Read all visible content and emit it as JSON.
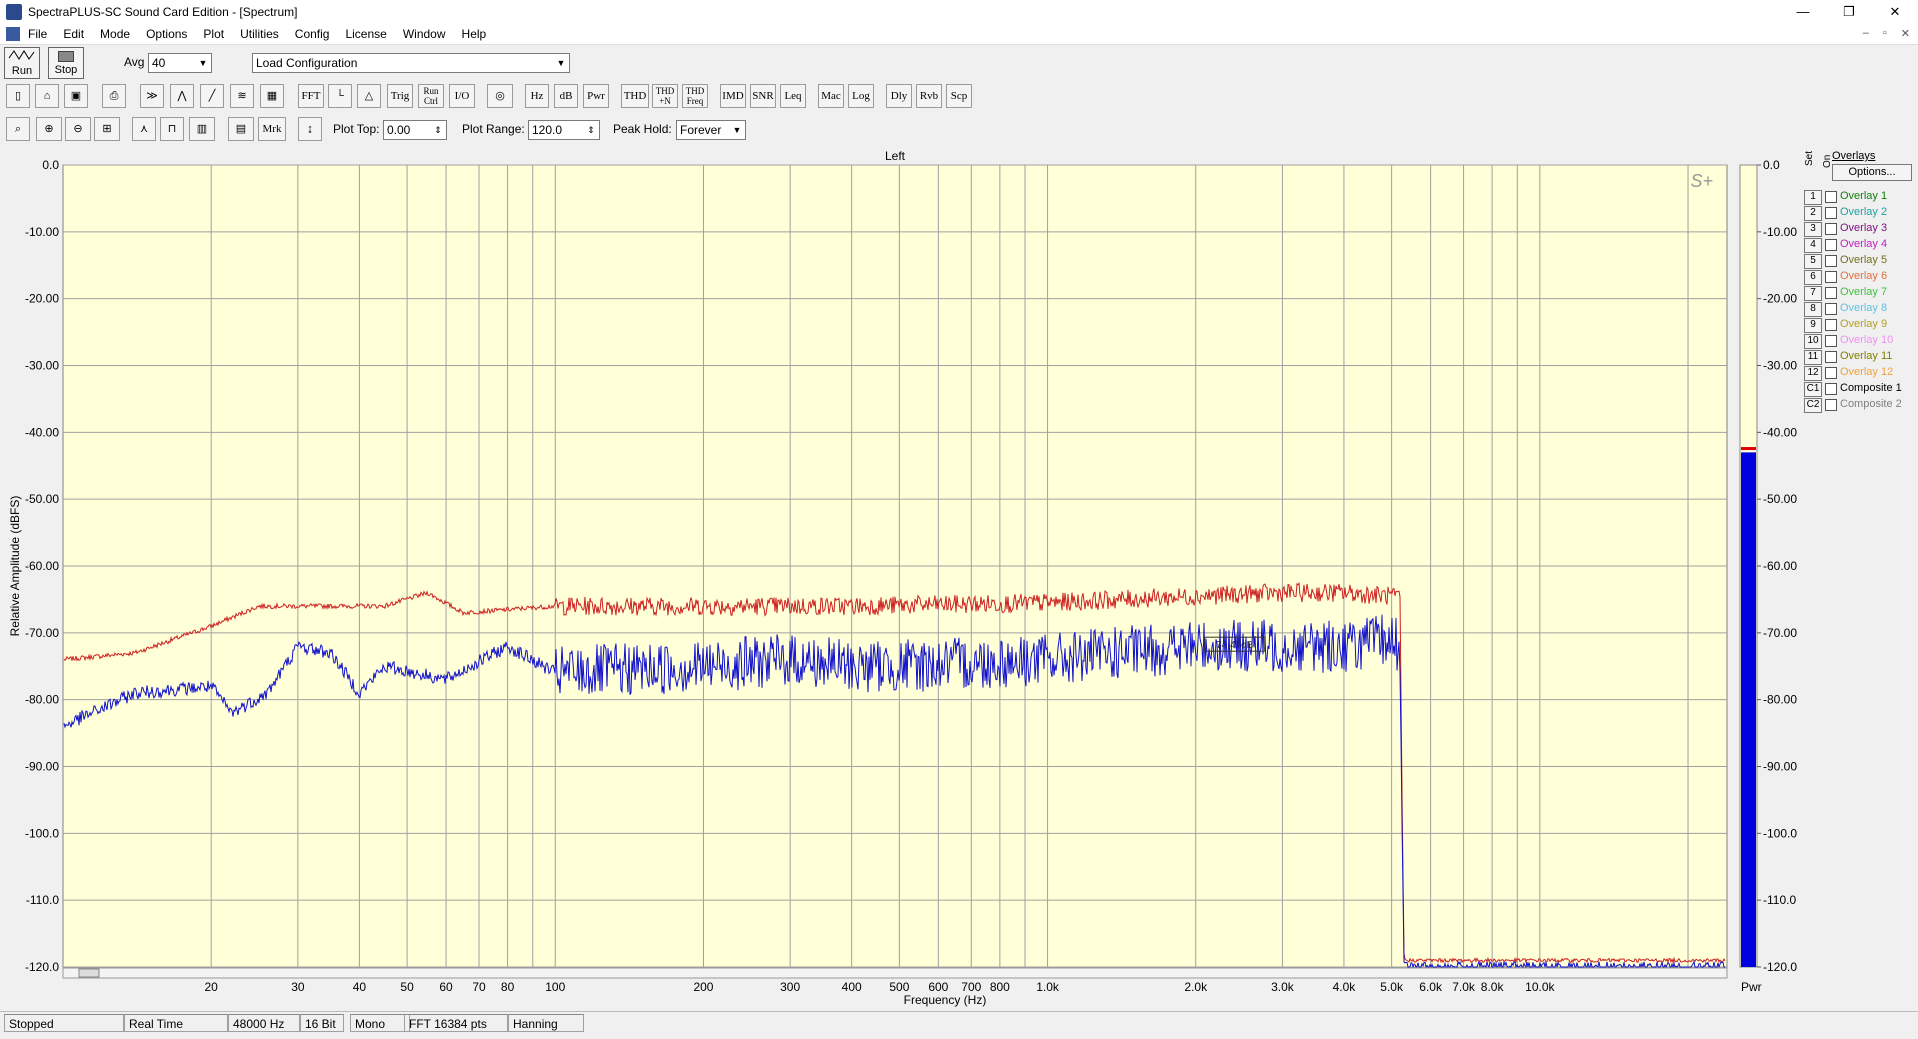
{
  "window": {
    "title": "SpectraPLUS-SC Sound Card Edition - [Spectrum]",
    "controls": [
      "—",
      "❐",
      "✕"
    ],
    "mdi_controls": [
      "–",
      "▫",
      "✕"
    ]
  },
  "menu": [
    "File",
    "Edit",
    "Mode",
    "Options",
    "Plot",
    "Utilities",
    "Config",
    "License",
    "Window",
    "Help"
  ],
  "toolbar1": {
    "run_label": "Run",
    "stop_label": "Stop",
    "avg_label": "Avg",
    "avg_value": "40",
    "config_value": "Load Configuration"
  },
  "toolbar2": [
    "FFT",
    "Trig",
    "Run Ctrl",
    "I/O",
    "Hz",
    "dB",
    "Pwr",
    "THD",
    "THD +N",
    "THD Freq",
    "IMD",
    "SNR",
    "Leq",
    "Mac",
    "Log",
    "Dly",
    "Rvb",
    "Scp"
  ],
  "toolbar3": {
    "buttons": [
      "Mrk"
    ],
    "plot_top_label": "Plot Top:",
    "plot_top_value": "0.00",
    "plot_range_label": "Plot Range:",
    "plot_range_value": "120.0",
    "peak_hold_label": "Peak Hold:",
    "peak_hold_value": "Forever"
  },
  "chart_data": {
    "type": "line",
    "title": "Left",
    "xlabel": "Frequency (Hz)",
    "ylabel": "Relative Amplitude (dBFS)",
    "x_scale": "log",
    "xlim": [
      10,
      24000
    ],
    "ylim": [
      -120,
      0
    ],
    "grid": true,
    "background": "#ffffd8",
    "y_ticks": [
      "0.0",
      "-10.00",
      "-20.00",
      "-30.00",
      "-40.00",
      "-50.00",
      "-60.00",
      "-70.00",
      "-80.00",
      "-90.00",
      "-100.0",
      "-110.0",
      "-120.0"
    ],
    "x_ticks": [
      {
        "v": 20,
        "label": "20"
      },
      {
        "v": 30,
        "label": "30"
      },
      {
        "v": 40,
        "label": "40"
      },
      {
        "v": 50,
        "label": "50"
      },
      {
        "v": 60,
        "label": "60"
      },
      {
        "v": 70,
        "label": "70"
      },
      {
        "v": 80,
        "label": "80"
      },
      {
        "v": 100,
        "label": "100"
      },
      {
        "v": 200,
        "label": "200"
      },
      {
        "v": 300,
        "label": "300"
      },
      {
        "v": 400,
        "label": "400"
      },
      {
        "v": 500,
        "label": "500"
      },
      {
        "v": 600,
        "label": "600"
      },
      {
        "v": 700,
        "label": "700"
      },
      {
        "v": 800,
        "label": "800"
      },
      {
        "v": 1000,
        "label": "1.0k"
      },
      {
        "v": 2000,
        "label": "2.0k"
      },
      {
        "v": 3000,
        "label": "3.0k"
      },
      {
        "v": 4000,
        "label": "4.0k"
      },
      {
        "v": 5000,
        "label": "5.0k"
      },
      {
        "v": 6000,
        "label": "6.0k"
      },
      {
        "v": 7000,
        "label": "7.0k"
      },
      {
        "v": 8000,
        "label": "8.0k"
      },
      {
        "v": 10000,
        "label": "10.0k"
      }
    ],
    "series": [
      {
        "color": "#cc2020",
        "points": [
          [
            10,
            -74
          ],
          [
            14,
            -73
          ],
          [
            20,
            -69
          ],
          [
            25,
            -66
          ],
          [
            35,
            -66
          ],
          [
            45,
            -66
          ],
          [
            55,
            -64
          ],
          [
            65,
            -67
          ],
          [
            100,
            -66
          ],
          [
            200,
            -66
          ],
          [
            400,
            -66
          ],
          [
            1000,
            -65.5
          ],
          [
            2000,
            -64.5
          ],
          [
            3000,
            -64
          ],
          [
            4000,
            -64
          ],
          [
            5000,
            -64.5
          ],
          [
            5200,
            -65
          ],
          [
            5250,
            -95
          ],
          [
            5300,
            -119
          ],
          [
            8000,
            -119
          ],
          [
            24000,
            -119
          ]
        ],
        "jitter": 1.4
      },
      {
        "color": "#1010cc",
        "points": [
          [
            10,
            -84
          ],
          [
            14,
            -79
          ],
          [
            20,
            -78
          ],
          [
            22,
            -82
          ],
          [
            26,
            -79
          ],
          [
            30,
            -72
          ],
          [
            35,
            -73
          ],
          [
            40,
            -79
          ],
          [
            45,
            -75
          ],
          [
            60,
            -77
          ],
          [
            80,
            -72
          ],
          [
            100,
            -76
          ],
          [
            200,
            -75
          ],
          [
            300,
            -74
          ],
          [
            400,
            -75
          ],
          [
            500,
            -75
          ],
          [
            1000,
            -74
          ],
          [
            2000,
            -72
          ],
          [
            3000,
            -72
          ],
          [
            4000,
            -72
          ],
          [
            5000,
            -71
          ],
          [
            5200,
            -72
          ],
          [
            5250,
            -100
          ],
          [
            5300,
            -120
          ],
          [
            24000,
            -120
          ]
        ],
        "jitter": 4.0
      }
    ],
    "marker_label": "74.47dB",
    "meter": {
      "label": "Pwr",
      "level": -43,
      "peak": -42.5,
      "color": "#0000e0",
      "peak_color": "#e00000"
    }
  },
  "overlays": {
    "title": "Overlays",
    "options_label": "Options...",
    "set_label": "Set",
    "on_label": "On",
    "items": [
      {
        "num": "1",
        "name": "Overlay 1",
        "color": "#108010"
      },
      {
        "num": "2",
        "name": "Overlay 2",
        "color": "#20a0a0"
      },
      {
        "num": "3",
        "name": "Overlay 3",
        "color": "#801080"
      },
      {
        "num": "4",
        "name": "Overlay 4",
        "color": "#c020c0"
      },
      {
        "num": "5",
        "name": "Overlay 5",
        "color": "#707020"
      },
      {
        "num": "6",
        "name": "Overlay 6",
        "color": "#e07040"
      },
      {
        "num": "7",
        "name": "Overlay 7",
        "color": "#40c040"
      },
      {
        "num": "8",
        "name": "Overlay 8",
        "color": "#60c0e0"
      },
      {
        "num": "9",
        "name": "Overlay 9",
        "color": "#b0a020"
      },
      {
        "num": "10",
        "name": "Overlay 10",
        "color": "#f090f0"
      },
      {
        "num": "11",
        "name": "Overlay 11",
        "color": "#808000"
      },
      {
        "num": "12",
        "name": "Overlay 12",
        "color": "#f0a040"
      },
      {
        "num": "C1",
        "name": "Composite 1",
        "color": "#000000"
      },
      {
        "num": "C2",
        "name": "Composite 2",
        "color": "#808080"
      }
    ]
  },
  "status": [
    "Stopped",
    "Real Time",
    "48000 Hz",
    "16 Bit",
    "Mono",
    "FFT 16384 pts",
    "Hanning"
  ]
}
